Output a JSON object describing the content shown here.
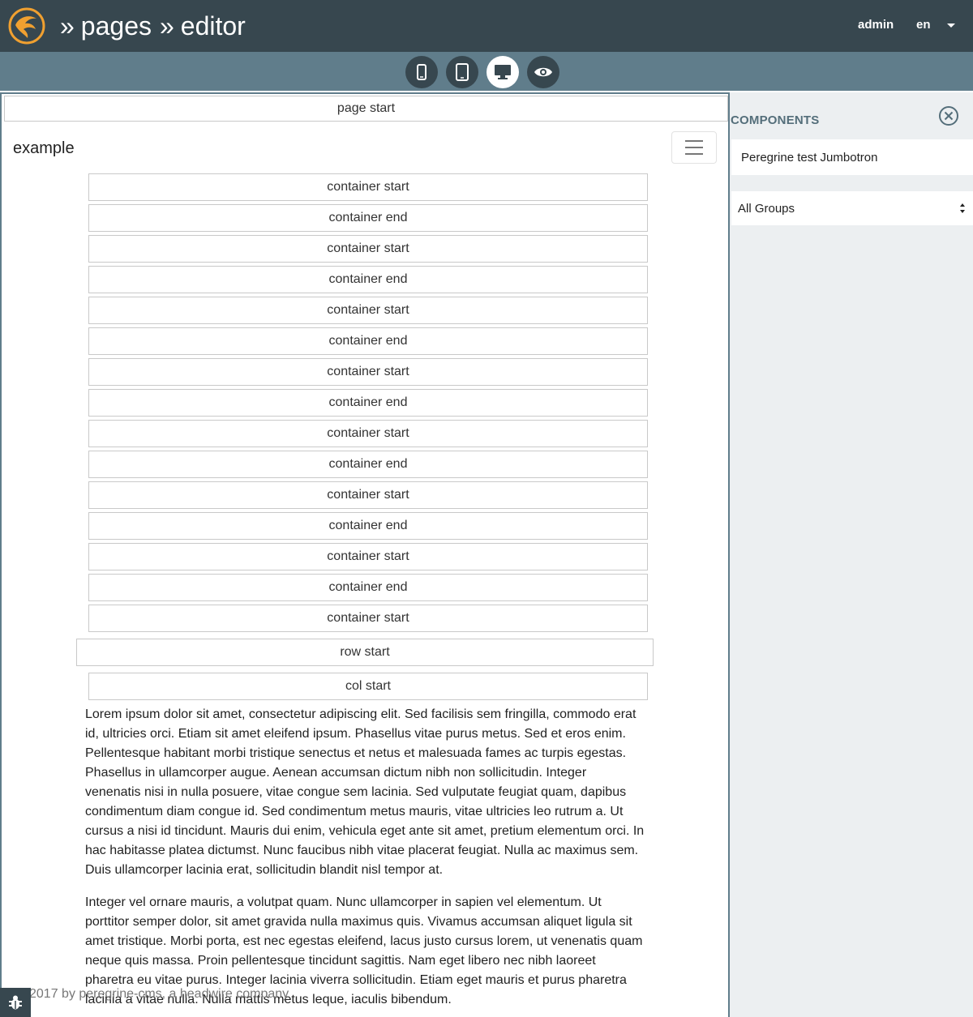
{
  "header": {
    "breadcrumb": [
      "pages",
      "editor"
    ],
    "separator": "»",
    "user": "admin",
    "language": "en",
    "colors": {
      "bar": "#37474f",
      "logo": "#f0a030"
    }
  },
  "toolbar": {
    "devices": [
      {
        "name": "mobile",
        "icon": "smartphone-icon",
        "active": false
      },
      {
        "name": "tablet",
        "icon": "tablet-icon",
        "active": false
      },
      {
        "name": "desktop",
        "icon": "desktop-icon",
        "active": true
      },
      {
        "name": "preview",
        "icon": "eye-icon",
        "active": false
      }
    ]
  },
  "editor": {
    "page_start": "page start",
    "brand": "example",
    "containers": [
      "container start",
      "container end",
      "container start",
      "container end",
      "container start",
      "container end",
      "container start",
      "container end",
      "container start",
      "container end",
      "container start",
      "container end",
      "container start",
      "container end",
      "container start"
    ],
    "row_start": "row start",
    "col_start": "col start",
    "paragraphs": [
      "Lorem ipsum dolor sit amet, consectetur adipiscing elit. Sed facilisis sem fringilla, commodo erat id, ultricies orci. Etiam sit amet eleifend ipsum. Phasellus vitae purus metus. Sed et eros enim. Pellentesque habitant morbi tristique senectus et netus et malesuada fames ac turpis egestas. Phasellus in ullamcorper augue. Aenean accumsan dictum nibh non sollicitudin. Integer venenatis nisi in nulla posuere, vitae congue sem lacinia. Sed vulputate feugiat quam, dapibus condimentum diam congue id. Sed condimentum metus mauris, vitae ultricies leo rutrum a. Ut cursus a nisi id tincidunt. Mauris dui enim, vehicula eget ante sit amet, pretium elementum orci. In hac habitasse platea dictumst. Nunc faucibus nibh vitae placerat feugiat. Nulla ac maximus sem. Duis ullamcorper lacinia erat, sollicitudin blandit nisl tempor at.",
      "Integer vel ornare mauris, a volutpat quam. Nunc ullamcorper in sapien vel elementum. Ut porttitor semper dolor, sit amet gravida nulla maximus quis. Vivamus accumsan aliquet ligula sit amet tristique. Morbi porta, est nec egestas eleifend, lacus justo cursus lorem, ut venenatis quam neque quis massa. Proin pellentesque tincidunt sagittis. Nam eget libero nec nibh laoreet pharetra eu vitae purus. Integer lacinia viverra sollicitudin. Etiam eget mauris et purus pharetra lacinia a vitae nulla. Nulla mattis metus leque, iaculis bibendum."
    ],
    "footer": "2017 by peregrine-cms, a headwire company"
  },
  "panel": {
    "title": "COMPONENTS",
    "search_value": "Peregrine test Jumbotron",
    "group_selected": "All Groups"
  }
}
